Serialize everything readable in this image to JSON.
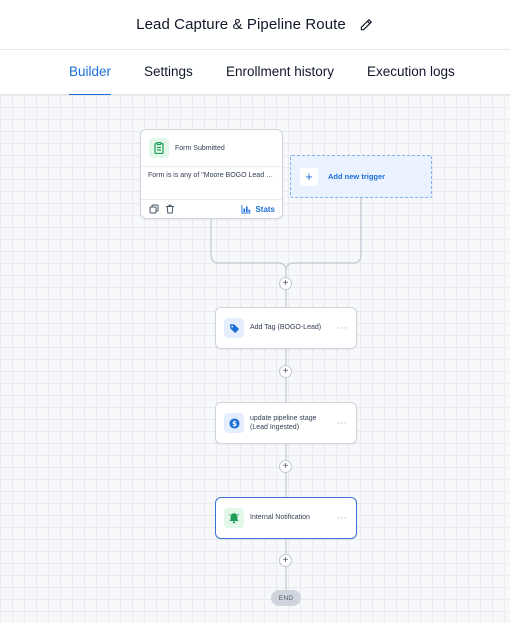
{
  "header": {
    "title": "Lead Capture & Pipeline Route",
    "edit_icon": "pencil-icon"
  },
  "tabs": [
    {
      "label": "Builder",
      "active": true
    },
    {
      "label": "Settings",
      "active": false
    },
    {
      "label": "Enrollment history",
      "active": false
    },
    {
      "label": "Execution logs",
      "active": false
    }
  ],
  "trigger": {
    "icon": "form-clipboard-icon",
    "title": "Form Submitted",
    "condition": "Form is is any of \"Moore BOGO Lead Capture\"",
    "footer": {
      "copy_icon": "copy-icon",
      "delete_icon": "trash-icon",
      "stats_label": "Stats",
      "stats_icon": "bar-chart-icon"
    }
  },
  "add_trigger": {
    "label": "Add new trigger",
    "icon": "plus-icon"
  },
  "actions": [
    {
      "icon": "tag-icon",
      "label": "Add Tag (BOGO-Lead)"
    },
    {
      "icon": "dollar-icon",
      "label_line1": "update pipeline stage",
      "label_line2": "(Lead Ingested)"
    },
    {
      "icon": "bell-icon",
      "label": "Internal Notification"
    }
  ],
  "plus_symbol": "+",
  "more_symbol": "···",
  "end_label": "END",
  "colors": {
    "accent": "#1d6fd8",
    "selected_border": "#3b72d8",
    "connector": "#c4c9d2"
  }
}
